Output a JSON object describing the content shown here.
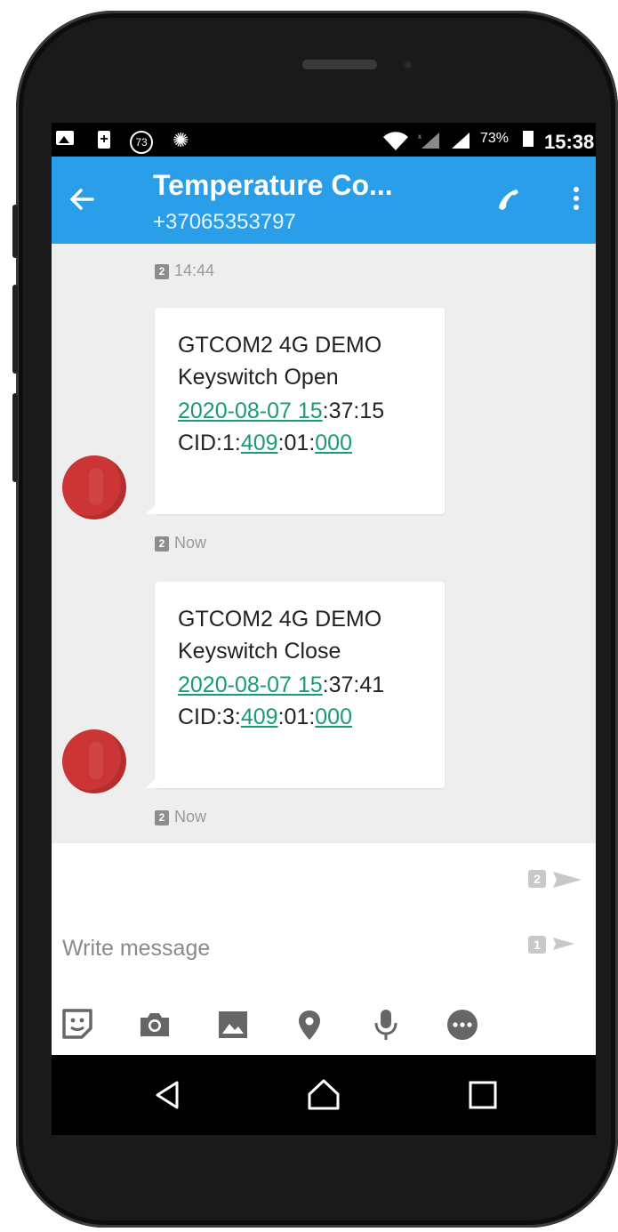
{
  "status_bar": {
    "notif_count": "73",
    "battery_percent": "73%",
    "time": "15:38"
  },
  "header": {
    "title": "Temperature Co...",
    "phone_number": "+37065353797"
  },
  "messages": [
    {
      "sim": "2",
      "time": "14:44",
      "lines": {
        "l1": "GTCOM2 4G DEMO",
        "l2": "Keyswitch Open",
        "date_link": "2020-08-07 15",
        "time_rest": ":37:15",
        "cid_prefix": "CID:1:",
        "cid_link1": "409",
        "cid_mid": ":01:",
        "cid_link2": "000"
      },
      "status_sim": "2",
      "status_time": "Now"
    },
    {
      "lines": {
        "l1": "GTCOM2 4G DEMO",
        "l2": "Keyswitch Close",
        "date_link": "2020-08-07 15",
        "time_rest": ":37:41",
        "cid_prefix": "CID:3:",
        "cid_link1": "409",
        "cid_mid": ":01:",
        "cid_link2": "000"
      },
      "status_sim": "2",
      "status_time": "Now"
    }
  ],
  "composer": {
    "placeholder": "Write message",
    "send_sim2_label": "2",
    "send_sim1_label": "1"
  },
  "icons": {
    "header": [
      "back-arrow-icon",
      "phone-icon",
      "more-vert-icon"
    ],
    "toolbar": [
      "sticker-icon",
      "camera-icon",
      "image-icon",
      "location-icon",
      "microphone-icon",
      "more-horiz-icon"
    ],
    "nav": [
      "back-triangle-icon",
      "home-icon",
      "recents-icon"
    ]
  },
  "colors": {
    "appbar": "#2a9ee9",
    "link": "#1a9b78",
    "avatar": "#cc3535",
    "conversation_bg": "#eeeeee"
  }
}
